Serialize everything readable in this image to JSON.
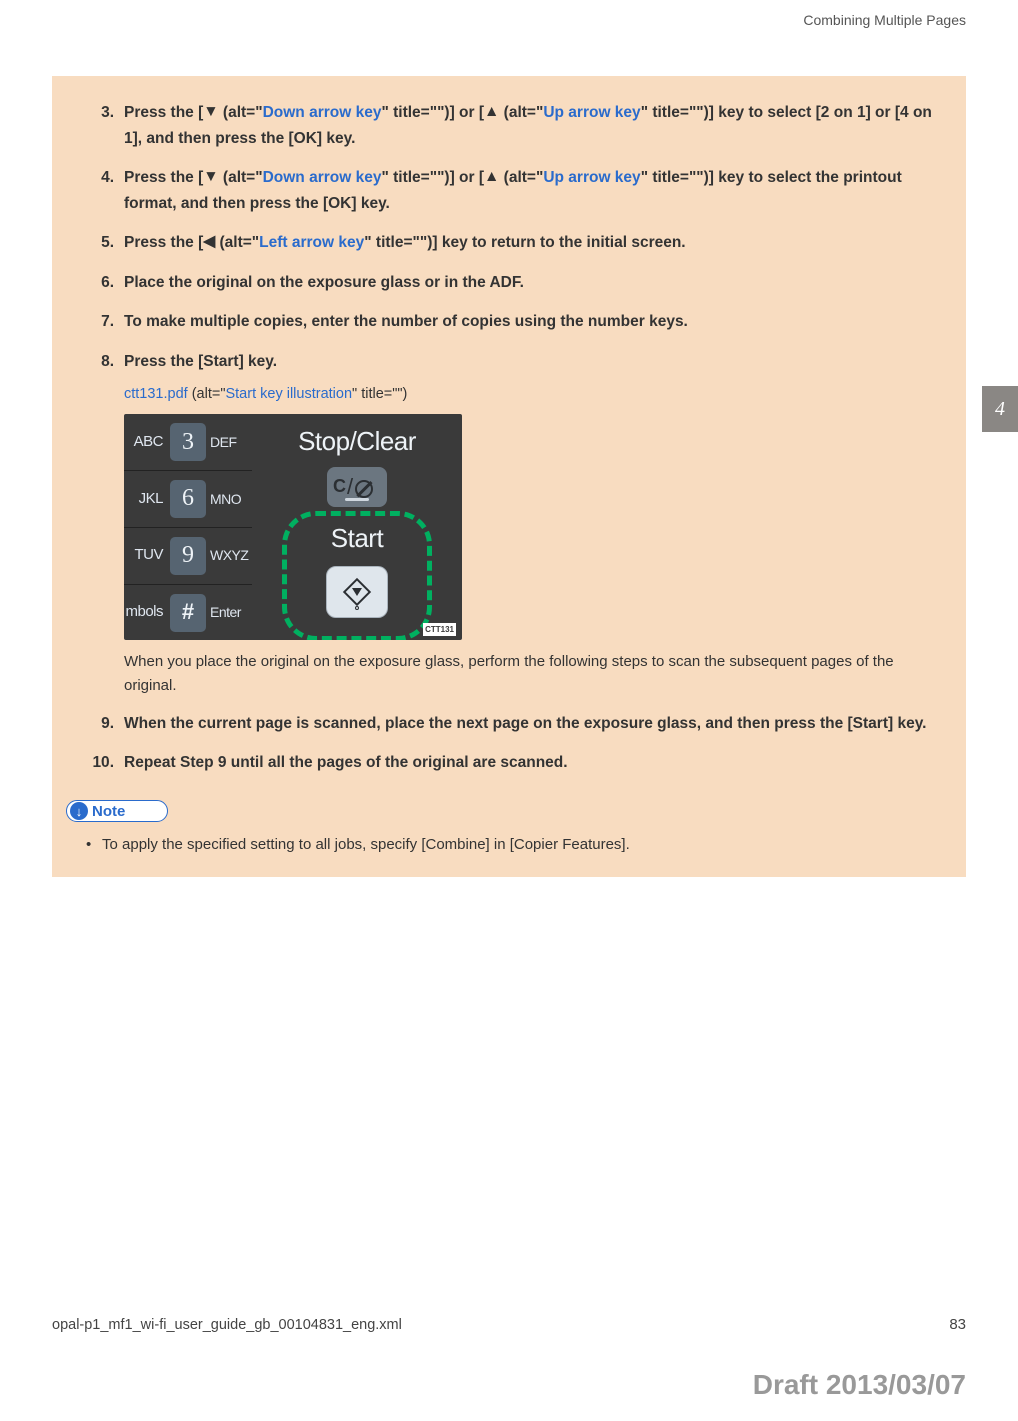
{
  "header": {
    "title": "Combining Multiple Pages"
  },
  "chapter_tab": "4",
  "alt_refs": {
    "down_arrow": "Down arrow key",
    "up_arrow": "Up arrow key",
    "left_arrow": "Left arrow key",
    "start_illus": "Start key illustration"
  },
  "steps": {
    "s3a": "Press the [",
    "s3b": " (alt=\"",
    "s3c": "\" title=\"\")] or [",
    "s3d": " (alt=\"",
    "s3e": "\" title=\"\")] key to select [2 on 1] or [4 on 1], and then press the [OK] key.",
    "s4a": "Press the [",
    "s4b": " (alt=\"",
    "s4c": "\" title=\"\")] or [",
    "s4d": " (alt=\"",
    "s4e": "\" title=\"\")] key to select the printout format, and then press the [OK] key.",
    "s5a": "Press the [",
    "s5b": " (alt=\"",
    "s5c": "\" title=\"\")] key to return to the initial screen.",
    "s6": "Place the original on the exposure glass or in the ADF.",
    "s7": "To make multiple copies, enter the number of copies using the number keys.",
    "s8": "Press the [Start] key.",
    "s8_pdf": "ctt131.pdf",
    "s8_alt_open": " (alt=\"",
    "s8_alt_close": "\" title=\"\")",
    "s8_note": "When you place the original on the exposure glass, perform the following steps to scan the subsequent pages of the original.",
    "s9": "When the current page is scanned, place the next page on the exposure glass, and then press the [Start] key.",
    "s10": "Repeat Step 9 until all the pages of the original are scanned."
  },
  "panel": {
    "rows": [
      {
        "left": "ABC",
        "key": "3",
        "right": "DEF"
      },
      {
        "left": "JKL",
        "key": "6",
        "right": "MNO"
      },
      {
        "left": "TUV",
        "key": "9",
        "right": "WXYZ"
      },
      {
        "left": "mbols",
        "key": "#",
        "right": "Enter"
      }
    ],
    "stopclear": "Stop/Clear",
    "stop_c": "C",
    "start": "Start",
    "ctt": "CTT131"
  },
  "note": {
    "label": "Note",
    "item1": "To apply the specified setting to all jobs, specify [Combine] in [Copier Features]."
  },
  "footer": {
    "file": "opal-p1_mf1_wi-fi_user_guide_gb_00104831_eng.xml",
    "page": "83",
    "draft": "Draft 2013/03/07"
  }
}
